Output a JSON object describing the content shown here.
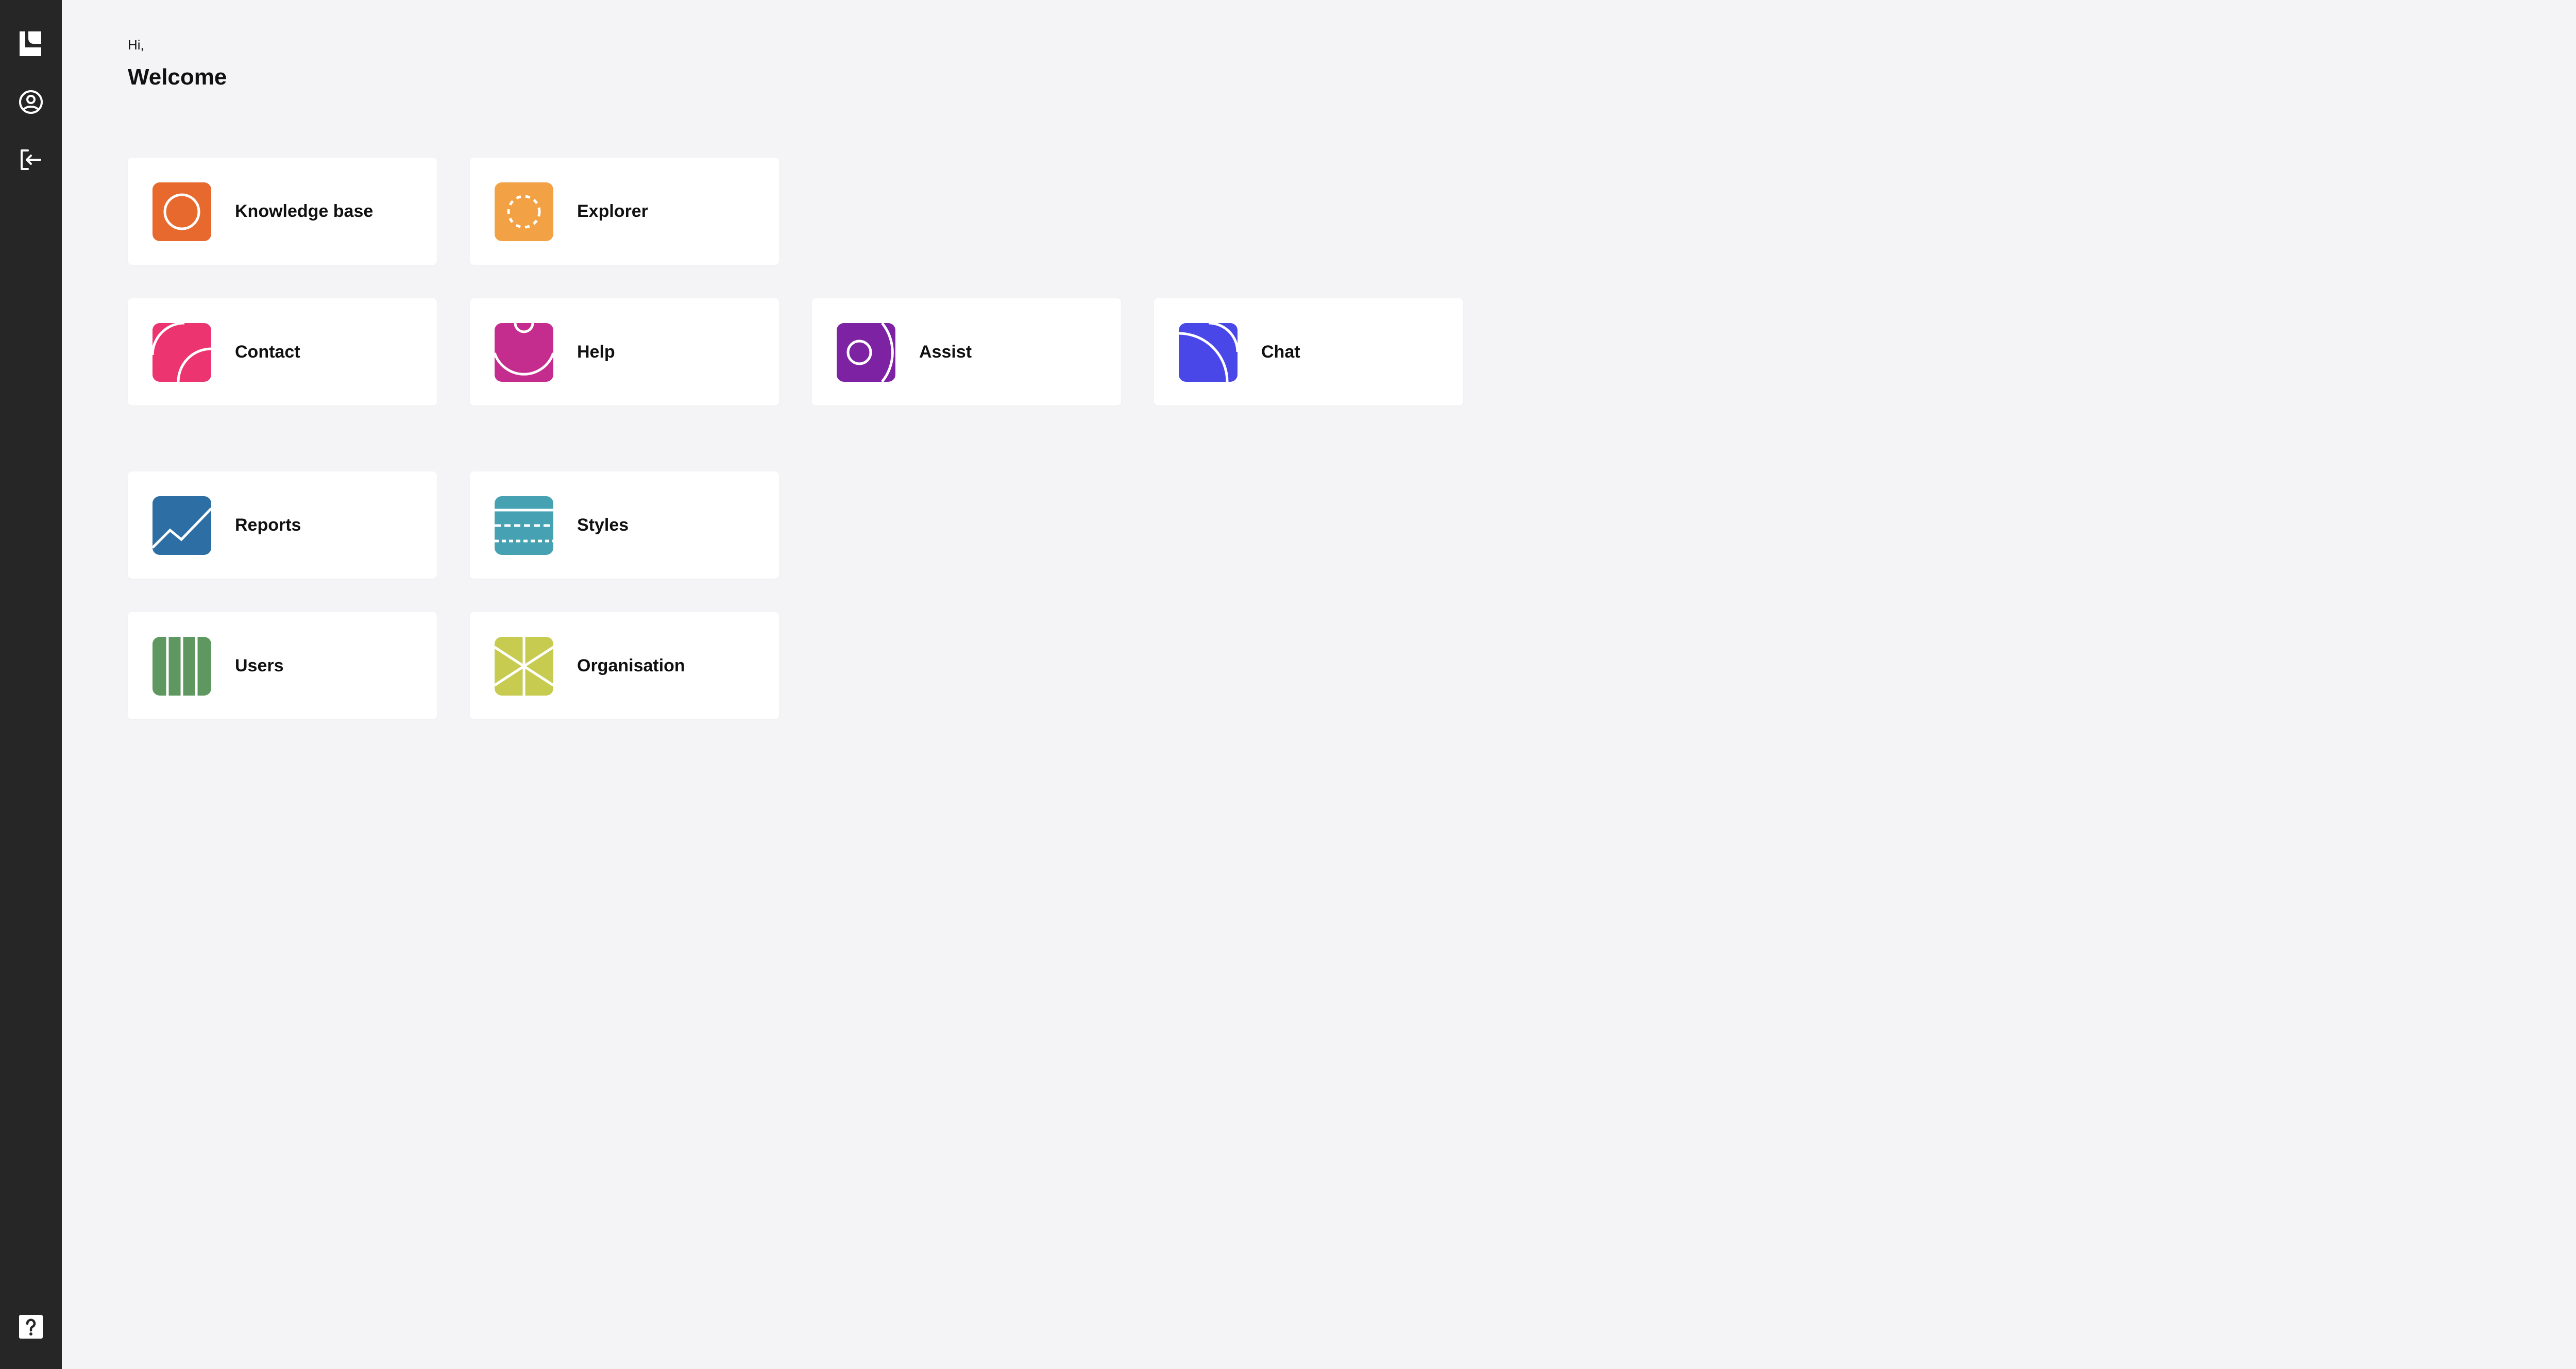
{
  "sidebar": {
    "items": [
      {
        "icon": "logo-icon"
      },
      {
        "icon": "user-profile-icon"
      },
      {
        "icon": "logout-icon"
      },
      {
        "icon": "help-icon"
      }
    ]
  },
  "header": {
    "greeting": "Hi,",
    "title": "Welcome"
  },
  "cards": [
    {
      "label": "Knowledge base",
      "icon": "knowledge-base-icon",
      "color": "#e8692e"
    },
    {
      "label": "Explorer",
      "icon": "explorer-icon",
      "color": "#f2a245"
    },
    {
      "label": "Contact",
      "icon": "contact-icon",
      "color": "#ec3470"
    },
    {
      "label": "Help",
      "icon": "help-tile-icon",
      "color": "#c42c8e"
    },
    {
      "label": "Assist",
      "icon": "assist-icon",
      "color": "#7e22a4"
    },
    {
      "label": "Chat",
      "icon": "chat-icon",
      "color": "#4a47e8"
    },
    {
      "label": "Reports",
      "icon": "reports-icon",
      "color": "#2d6ea4"
    },
    {
      "label": "Styles",
      "icon": "styles-icon",
      "color": "#46a2b2"
    },
    {
      "label": "Users",
      "icon": "users-icon",
      "color": "#5e9860"
    },
    {
      "label": "Organisation",
      "icon": "organisation-icon",
      "color": "#c7cc50"
    }
  ]
}
